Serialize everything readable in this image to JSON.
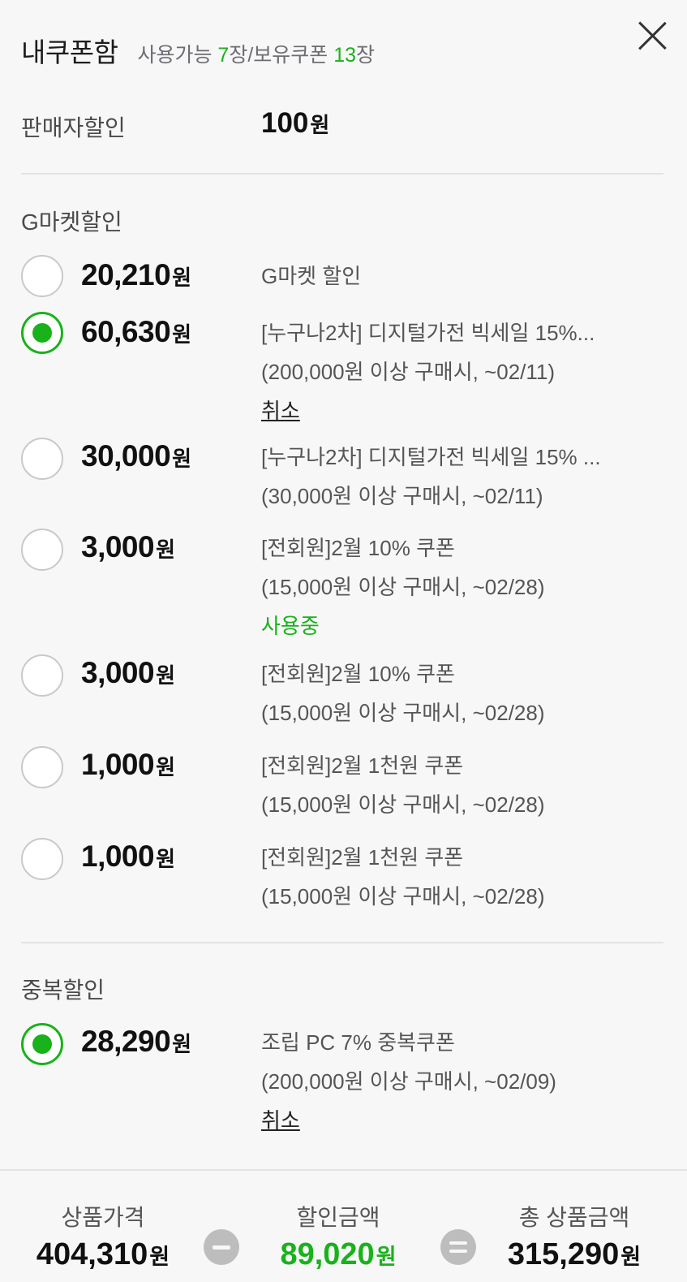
{
  "header": {
    "title": "내쿠폰함",
    "available_label": "사용가능 ",
    "available_count": "7",
    "available_unit": "장/보유쿠폰 ",
    "owned_count": "13",
    "owned_unit": "장"
  },
  "seller_discount": {
    "label": "판매자할인",
    "amount": "100",
    "unit": "원"
  },
  "gmarket": {
    "title": "G마켓할인",
    "coupons": [
      {
        "amount": "20,210",
        "unit": "원",
        "selected": false,
        "line1": "G마켓 할인",
        "line2": "",
        "action": ""
      },
      {
        "amount": "60,630",
        "unit": "원",
        "selected": true,
        "line1": "[누구나2차] 디지털가전 빅세일 15%...",
        "line2": "(200,000원 이상 구매시, ~02/11)",
        "action": "취소"
      },
      {
        "amount": "30,000",
        "unit": "원",
        "selected": false,
        "line1": "[누구나2차] 디지털가전 빅세일 15% ...",
        "line2": "(30,000원 이상 구매시, ~02/11)",
        "action": ""
      },
      {
        "amount": "3,000",
        "unit": "원",
        "selected": false,
        "line1": "[전회원]2월 10% 쿠폰",
        "line2": "(15,000원 이상 구매시, ~02/28)",
        "status": "사용중"
      },
      {
        "amount": "3,000",
        "unit": "원",
        "selected": false,
        "line1": "[전회원]2월 10% 쿠폰",
        "line2": "(15,000원 이상 구매시, ~02/28)"
      },
      {
        "amount": "1,000",
        "unit": "원",
        "selected": false,
        "line1": "[전회원]2월 1천원 쿠폰",
        "line2": "(15,000원 이상 구매시, ~02/28)"
      },
      {
        "amount": "1,000",
        "unit": "원",
        "selected": false,
        "line1": "[전회원]2월 1천원 쿠폰",
        "line2": "(15,000원 이상 구매시, ~02/28)"
      }
    ]
  },
  "duplicate": {
    "title": "중복할인",
    "coupons": [
      {
        "amount": "28,290",
        "unit": "원",
        "selected": true,
        "line1": "조립 PC 7% 중복쿠폰",
        "line2": "(200,000원 이상 구매시, ~02/09)",
        "action": "취소"
      }
    ]
  },
  "footer": {
    "price_label": "상품가격",
    "price": "404,310",
    "price_unit": "원",
    "discount_label": "할인금액",
    "discount": "89,020",
    "discount_unit": "원",
    "total_label": "총 상품금액",
    "total": "315,290",
    "total_unit": "원"
  },
  "icons": {
    "close": "close-icon",
    "minus": "minus-icon",
    "equals": "equals-icon"
  },
  "colors": {
    "accent": "#19b21b"
  }
}
